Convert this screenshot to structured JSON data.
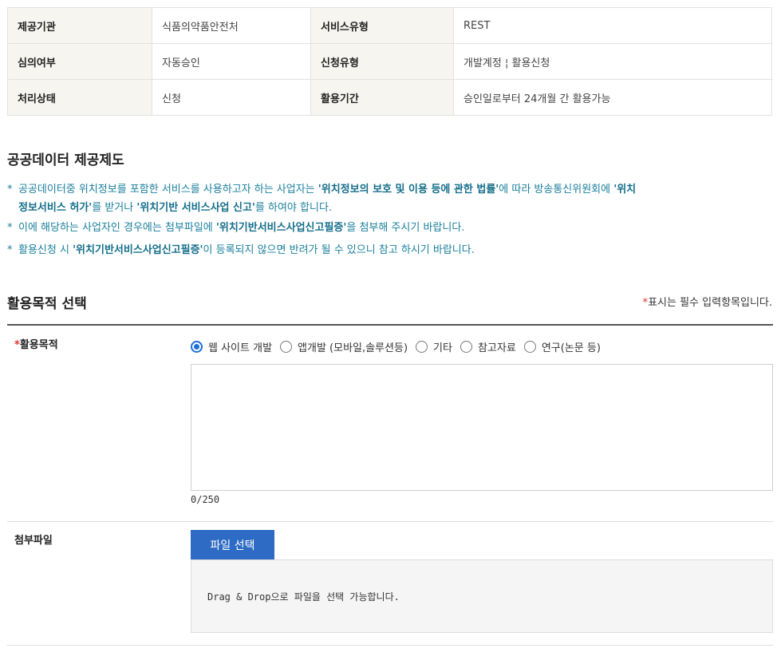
{
  "info": {
    "rows": [
      {
        "k1": "제공기관",
        "v1": "식품의약품안전처",
        "k2": "서비스유형",
        "v2": "REST"
      },
      {
        "k1": "심의여부",
        "v1": "자동승인",
        "k2": "신청유형",
        "v2": "개발계정 ¦ 활용신청"
      },
      {
        "k1": "처리상태",
        "v1": "신청",
        "k2": "활용기간",
        "v2": "승인일로부터 24개월 간 활용가능"
      }
    ]
  },
  "policy": {
    "title": "공공데이터 제공제도",
    "bullet": "*",
    "n1_a": "공공데이터중 위치정보를 포함한 서비스를 사용하고자 하는 사업자는 ",
    "n1_b": "'위치정보의 보호 및 이용 등에 관한 법률'",
    "n1_c": "에 따라 방송통신위원회에 ",
    "n1_d": "'위치",
    "n1_e": "정보서비스 허가'",
    "n1_f": "를 받거나 ",
    "n1_g": "'위치기반 서비스사업 신고'",
    "n1_h": "를 하여야 합니다.",
    "n2_a": "이에 해당하는 사업자인 경우에는 첨부파일에 ",
    "n2_b": "'위치기반서비스사업신고필증'",
    "n2_c": "을 첨부해 주시기 바랍니다.",
    "n3_a": "활용신청 시 ",
    "n3_b": "'위치기반서비스사업신고필증'",
    "n3_c": "이 등록되지 않으면 반려가 될 수 있으니 참고 하시기 바랍니다."
  },
  "purpose": {
    "title": "활용목적 선택",
    "required_star": "*",
    "required_note": "표시는 필수 입력항목입니다.",
    "label": "활용목적",
    "options": [
      "웹 사이트 개발",
      "앱개발 (모바일,솔루션등)",
      "기타",
      "참고자료",
      "연구(논문 등)"
    ],
    "selected_index": 0,
    "textarea_value": "",
    "counter": "0/250"
  },
  "attach": {
    "label": "첨부파일",
    "button": "파일 선택",
    "dropzone": "Drag & Drop으로 파일을 선택 가능합니다."
  },
  "colors": {
    "notice": "#1a7f9c",
    "accent": "#2e6bc4",
    "required": "#e03030"
  }
}
